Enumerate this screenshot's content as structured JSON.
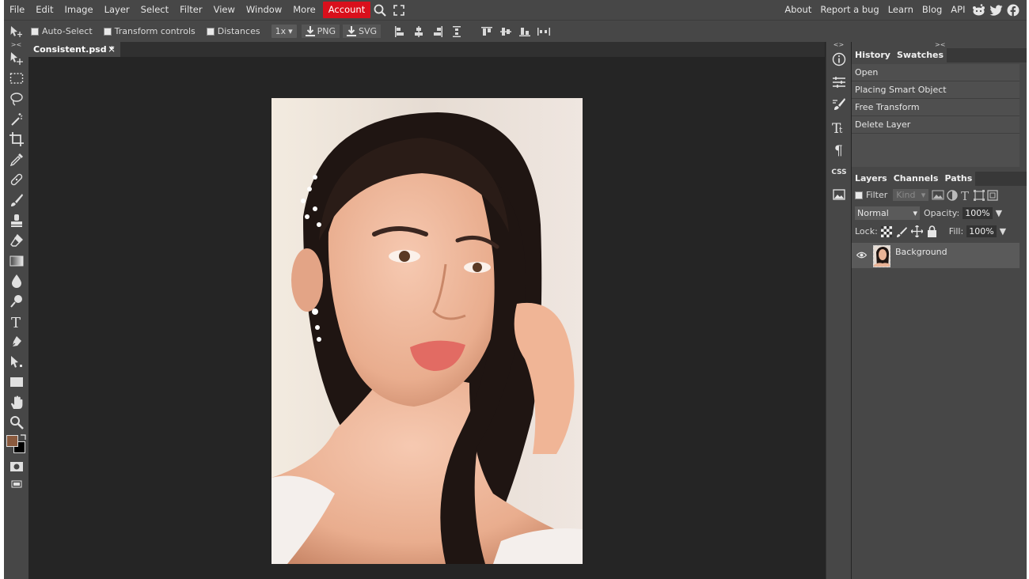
{
  "menubar": {
    "items": [
      "File",
      "Edit",
      "Image",
      "Layer",
      "Select",
      "Filter",
      "View",
      "Window",
      "More"
    ],
    "account": "Account",
    "right_links": [
      "About",
      "Report a bug",
      "Learn",
      "Blog",
      "API"
    ]
  },
  "options": {
    "auto_select": "Auto-Select",
    "transform_controls": "Transform controls",
    "distances": "Distances",
    "zoom": "1x",
    "png": "PNG",
    "svg": "SVG"
  },
  "document": {
    "tab_title": "Consistent.psd *",
    "close": "×"
  },
  "panels": {
    "iconcol": {
      "css_label": "CSS"
    },
    "history": {
      "tabs": [
        "History",
        "Swatches"
      ],
      "items": [
        "Open",
        "Placing Smart Object",
        "Free Transform",
        "Delete Layer"
      ]
    },
    "layers": {
      "tabs": [
        "Layers",
        "Channels",
        "Paths"
      ],
      "filter": "Filter",
      "kind": "Kind",
      "blend": "Normal",
      "opacity_label": "Opacity:",
      "opacity": "100%",
      "lock_label": "Lock:",
      "fill_label": "Fill:",
      "fill": "100%",
      "items": [
        {
          "name": "Background"
        }
      ]
    }
  },
  "colors": {
    "foreground": "#8a5a3e",
    "background": "#000000",
    "accent": "#d9101c"
  }
}
